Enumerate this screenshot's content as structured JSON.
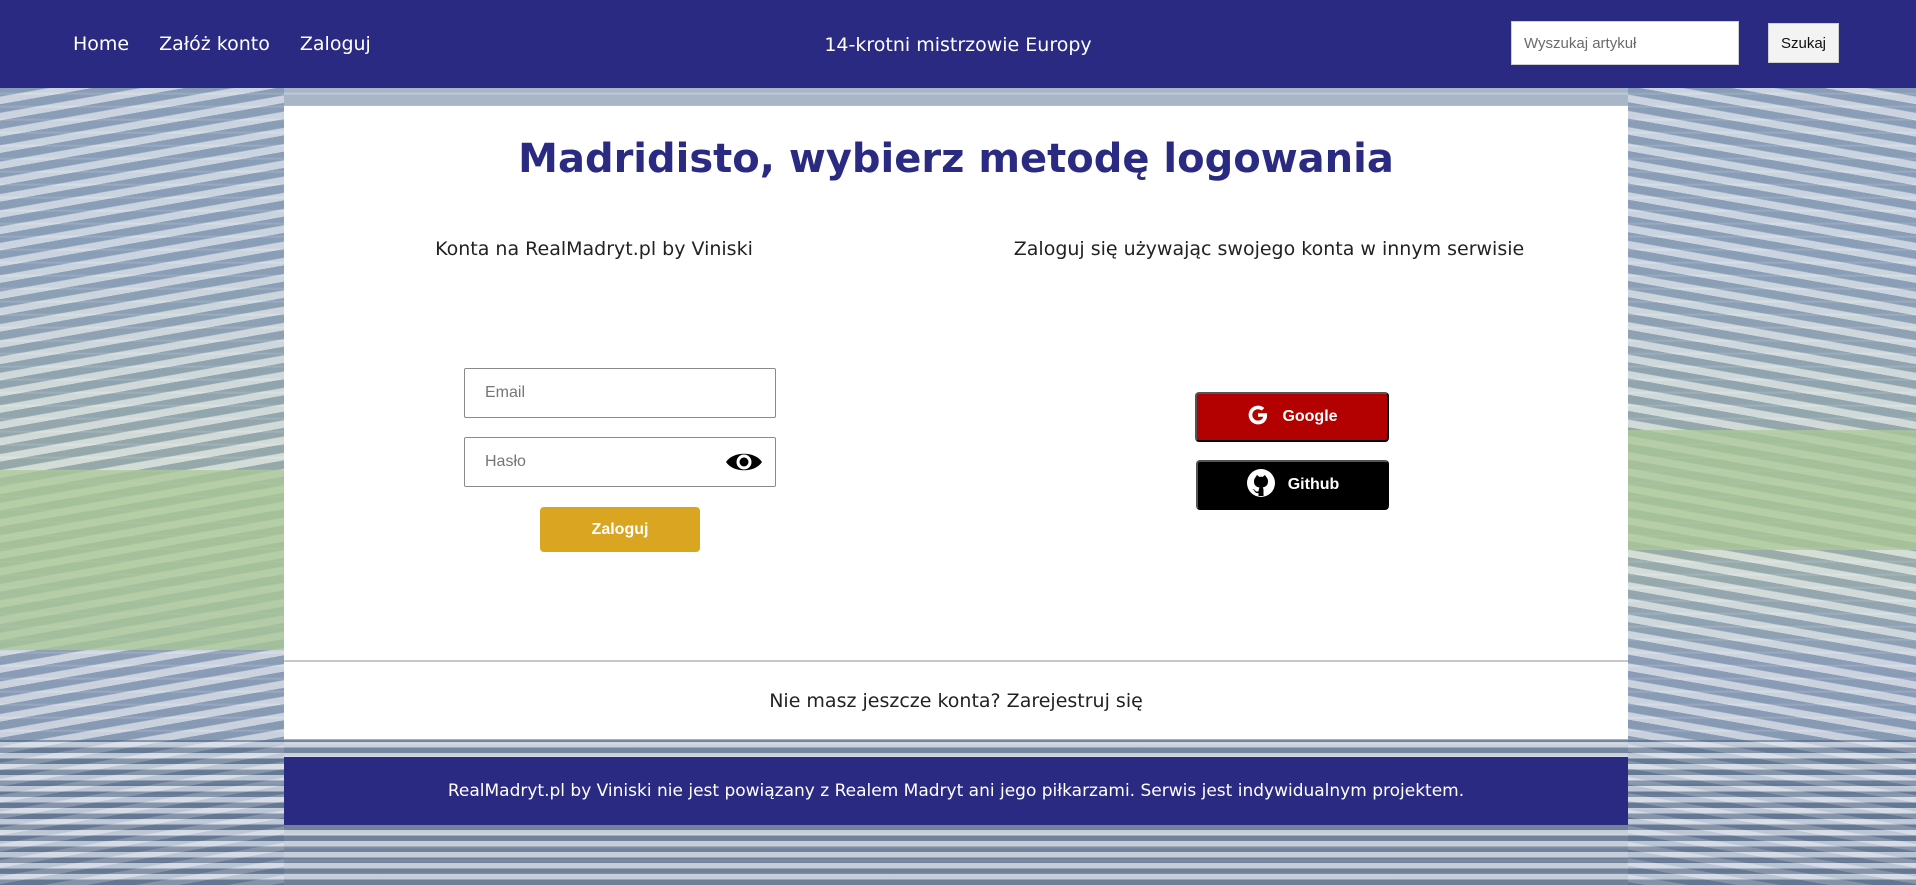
{
  "header": {
    "nav": [
      "Home",
      "Załóż konto",
      "Zaloguj"
    ],
    "tagline": "14-krotni mistrzowie Europy",
    "search_placeholder": "Wyszukaj artykuł",
    "search_button": "Szukaj"
  },
  "card": {
    "title": "Madridisto, wybierz metodę logowania",
    "left_title": "Konta na RealMadryt.pl by Viniski",
    "right_title": "Zaloguj się używając swojego konta w innym serwisie",
    "email_placeholder": "Email",
    "password_placeholder": "Hasło",
    "login_button": "Zaloguj",
    "google_button": "Google",
    "github_button": "Github",
    "register_text": "Nie masz jeszcze konta? Zarejestruj się"
  },
  "footer": {
    "text": "RealMadryt.pl by Viniski nie jest powiązany z Realem Madryt ani jego piłkarzami. Serwis jest indywidualnym projektem."
  },
  "colors": {
    "brand_navy": "#2a2a82",
    "gold": "#daa520",
    "google_red": "#b30000",
    "github_black": "#000000"
  },
  "icons": [
    "eye-icon",
    "google-icon",
    "github-icon"
  ]
}
